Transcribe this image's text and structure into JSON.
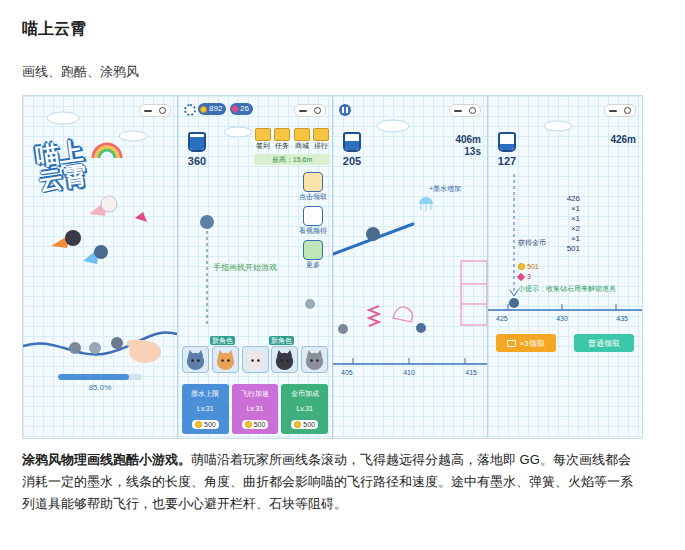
{
  "article": {
    "title": "喵上云霄",
    "tags": "画线、跑酷、涂鸦风",
    "lead": "涂鸦风物理画线跑酷小游戏。",
    "body": "萌喵沿着玩家所画线条滚动，飞得越远得分越高，落地即 GG。每次画线都会消耗一定的墨水，线条的长度、角度、曲折都会影响喵的飞行路径和速度。途中有墨水、弹簧、火焰等一系列道具能够帮助飞行，也要小心避开栏杆、石块等阻碍。"
  },
  "title_screen": {
    "logo": "喵上云霄",
    "loading": {
      "level": 0.85,
      "reading": "85.0%"
    }
  },
  "menu_screen": {
    "coins": "892",
    "diamonds": "26",
    "ink": "360",
    "menu": [
      "签到",
      "任务",
      "商城",
      "排行"
    ],
    "best": "最高：15.6m",
    "side_buttons": [
      "点击领取",
      "看视频得",
      "更多"
    ],
    "hint": "手指画线开始游戏",
    "cats": [
      {
        "badge": "",
        "color": "#5b7fa6"
      },
      {
        "badge": "新角色",
        "color": "#e8a25a"
      },
      {
        "badge": "",
        "color": "#f0e6e6"
      },
      {
        "badge": "新角色",
        "color": "#3a3a44"
      },
      {
        "badge": "",
        "color": "#8a8f9a"
      }
    ],
    "upgrades": [
      {
        "name": "墨水上限",
        "level": "Lv.31",
        "price": "500",
        "color": "#4a8fd8"
      },
      {
        "name": "飞行加速",
        "level": "Lv.31",
        "price": "500",
        "color": "#c96fd6"
      },
      {
        "name": "金币加成",
        "level": "Lv.31",
        "price": "500",
        "color": "#3fb07c"
      }
    ]
  },
  "play_screen": {
    "ink": "205",
    "distance": "406m",
    "time": "13s",
    "pickup": "+墨水增加",
    "axis": [
      "405",
      "410",
      "415"
    ]
  },
  "result_screen": {
    "ink": "127",
    "distance": "426m",
    "calc": [
      "426",
      "×1",
      "×1",
      "×2",
      "×1",
      "501"
    ],
    "reward_label": "获得金币",
    "coins": "501",
    "diamonds": "3",
    "tip": "小提示：收集钻石用来解锁道具",
    "axis": [
      "425",
      "430",
      "435"
    ],
    "buttons": [
      {
        "label": "×3领取",
        "kind": "video",
        "color": "#f5a623"
      },
      {
        "label": "普通领取",
        "kind": "plain",
        "color": "#3cc8a8"
      }
    ]
  }
}
